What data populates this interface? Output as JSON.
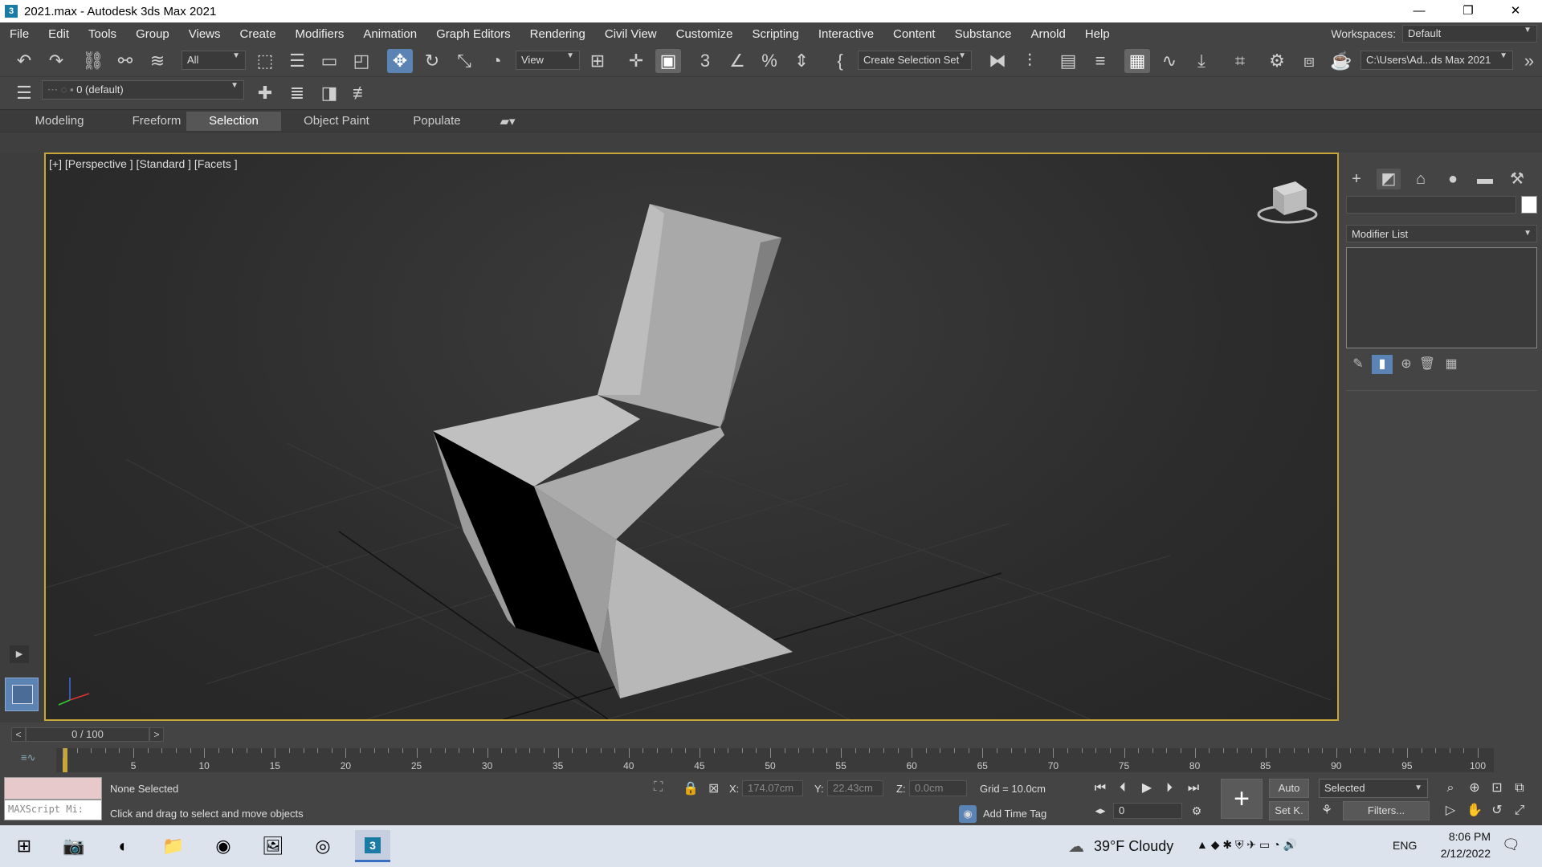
{
  "window": {
    "title": "2021.max - Autodesk 3ds Max 2021",
    "app_icon": "3",
    "minimize": "—",
    "maximize": "❐",
    "close": "✕"
  },
  "menu": {
    "items": [
      "File",
      "Edit",
      "Tools",
      "Group",
      "Views",
      "Create",
      "Modifiers",
      "Animation",
      "Graph Editors",
      "Rendering",
      "Civil View",
      "Customize",
      "Scripting",
      "Interactive",
      "Content",
      "Substance",
      "Arnold",
      "Help"
    ],
    "workspaces_label": "Workspaces:",
    "workspaces_value": "Default"
  },
  "toolbar": {
    "filter_value": "All",
    "refcoord_value": "View",
    "selection_set_value": "Create Selection Set",
    "project_path": "C:\\Users\\Ad...ds Max 2021",
    "layer_value": "0 (default)"
  },
  "ribbon": {
    "tabs": [
      "Modeling",
      "Freeform",
      "Selection",
      "Object Paint",
      "Populate"
    ],
    "active_tab": "Selection"
  },
  "viewport": {
    "label": "[+] [Perspective ] [Standard ] [Facets ]"
  },
  "command_panel": {
    "modifier_list": "Modifier List"
  },
  "timeline": {
    "frame_readout": "0 / 100",
    "prev": "<",
    "next": ">",
    "ticks": [
      "5",
      "10",
      "15",
      "20",
      "25",
      "30",
      "35",
      "40",
      "45",
      "50",
      "55",
      "60",
      "65",
      "70",
      "75",
      "80",
      "85",
      "90",
      "95",
      "100"
    ]
  },
  "status": {
    "maxscript_placeholder": "MAXScript Mi:",
    "selection_text": "None Selected",
    "prompt_text": "Click and drag to select and move objects",
    "x_label": "X:",
    "x_value": "174.07cm",
    "y_label": "Y:",
    "y_value": "22.43cm",
    "z_label": "Z:",
    "z_value": "0.0cm",
    "grid": "Grid = 10.0cm",
    "add_time_tag": "Add Time Tag",
    "auto_key": "Auto",
    "set_key": "Set K.",
    "key_mode": "Selected",
    "filters": "Filters...",
    "frame_value": "0"
  },
  "taskbar": {
    "weather": "39°F  Cloudy",
    "lang": "ENG",
    "time": "8:06 PM",
    "date": "2/12/2022"
  },
  "colors": {
    "viewport_border": "#c8a538",
    "active_blue": "#5b84b4",
    "chair_light": "#b8b8b8",
    "chair_dark": "#000000"
  }
}
